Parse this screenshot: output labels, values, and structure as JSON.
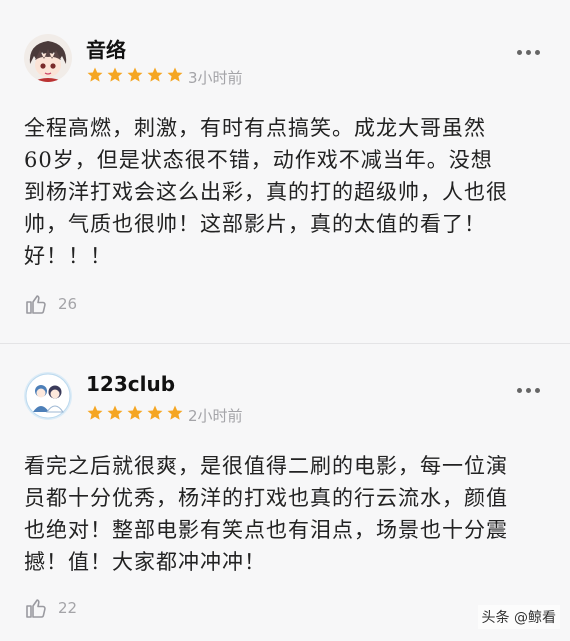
{
  "reviews": [
    {
      "username": "音络",
      "rating": 5,
      "time": "3小时前",
      "lines": [
        "全程高燃，刺激，有时有点搞笑。成龙大哥虽然",
        "60岁，但是状态很不错，动作戏不减当年。没想",
        "到杨洋打戏会这么出彩，真的打的超级帅，人也很",
        "帅，气质也很帅！这部影片，真的太值的看了！",
        "好！！！"
      ],
      "likes": "26"
    },
    {
      "username": "123club",
      "rating": 5,
      "time": "2小时前",
      "lines": [
        "看完之后就很爽，是很值得二刷的电影，每一位演",
        "员都十分优秀，杨洋的打戏也真的行云流水，颜值",
        "也绝对！整部电影有笑点也有泪点，场景也十分震",
        "撼！值！大家都冲冲冲！"
      ],
      "likes": "22"
    }
  ],
  "watermark": "头条 @鲸看",
  "colors": {
    "star": "#f5a623",
    "muted": "#a4a4a8",
    "background": "#f7f7f8"
  }
}
